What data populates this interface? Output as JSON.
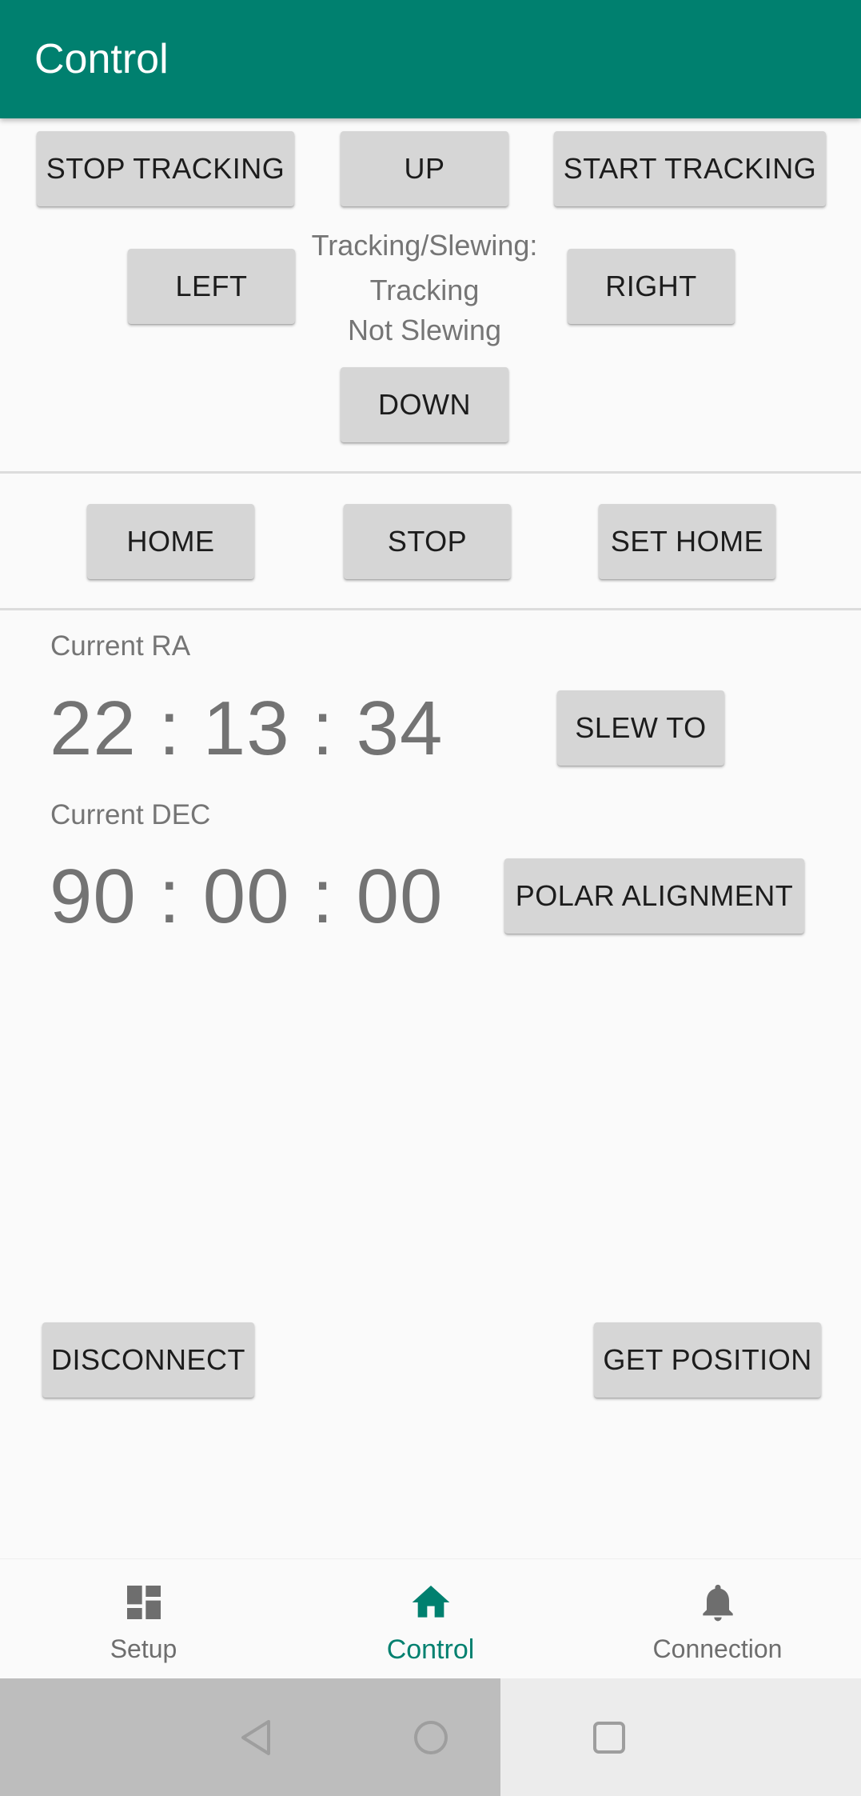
{
  "appbar": {
    "title": "Control"
  },
  "direction_pad": {
    "stop_tracking": "STOP TRACKING",
    "up": "UP",
    "start_tracking": "START TRACKING",
    "left": "LEFT",
    "right": "RIGHT",
    "down": "DOWN"
  },
  "status": {
    "heading": "Tracking/Slewing:",
    "tracking": "Tracking",
    "slewing": "Not Slewing"
  },
  "home_row": {
    "home": "HOME",
    "stop": "STOP",
    "set_home": "SET HOME"
  },
  "coordinates": {
    "ra_label": "Current RA",
    "ra_value": "22 : 13 : 34",
    "dec_label": "Current DEC",
    "dec_value": "90 : 00 : 00",
    "slew_to": "SLEW TO",
    "polar_alignment": "POLAR ALIGNMENT"
  },
  "actions": {
    "disconnect": "DISCONNECT",
    "get_position": "GET POSITION"
  },
  "bottom_nav": {
    "items": [
      {
        "label": "Setup",
        "icon": "dashboard-icon",
        "active": false
      },
      {
        "label": "Control",
        "icon": "home-icon",
        "active": true
      },
      {
        "label": "Connection",
        "icon": "bell-icon",
        "active": false
      }
    ]
  },
  "system_nav": {
    "icons": [
      "back-icon",
      "home-circle-icon",
      "recents-icon"
    ]
  },
  "colors": {
    "primary": "#00806f",
    "button_bg": "#d6d6d6",
    "secondary_text": "#757575"
  }
}
